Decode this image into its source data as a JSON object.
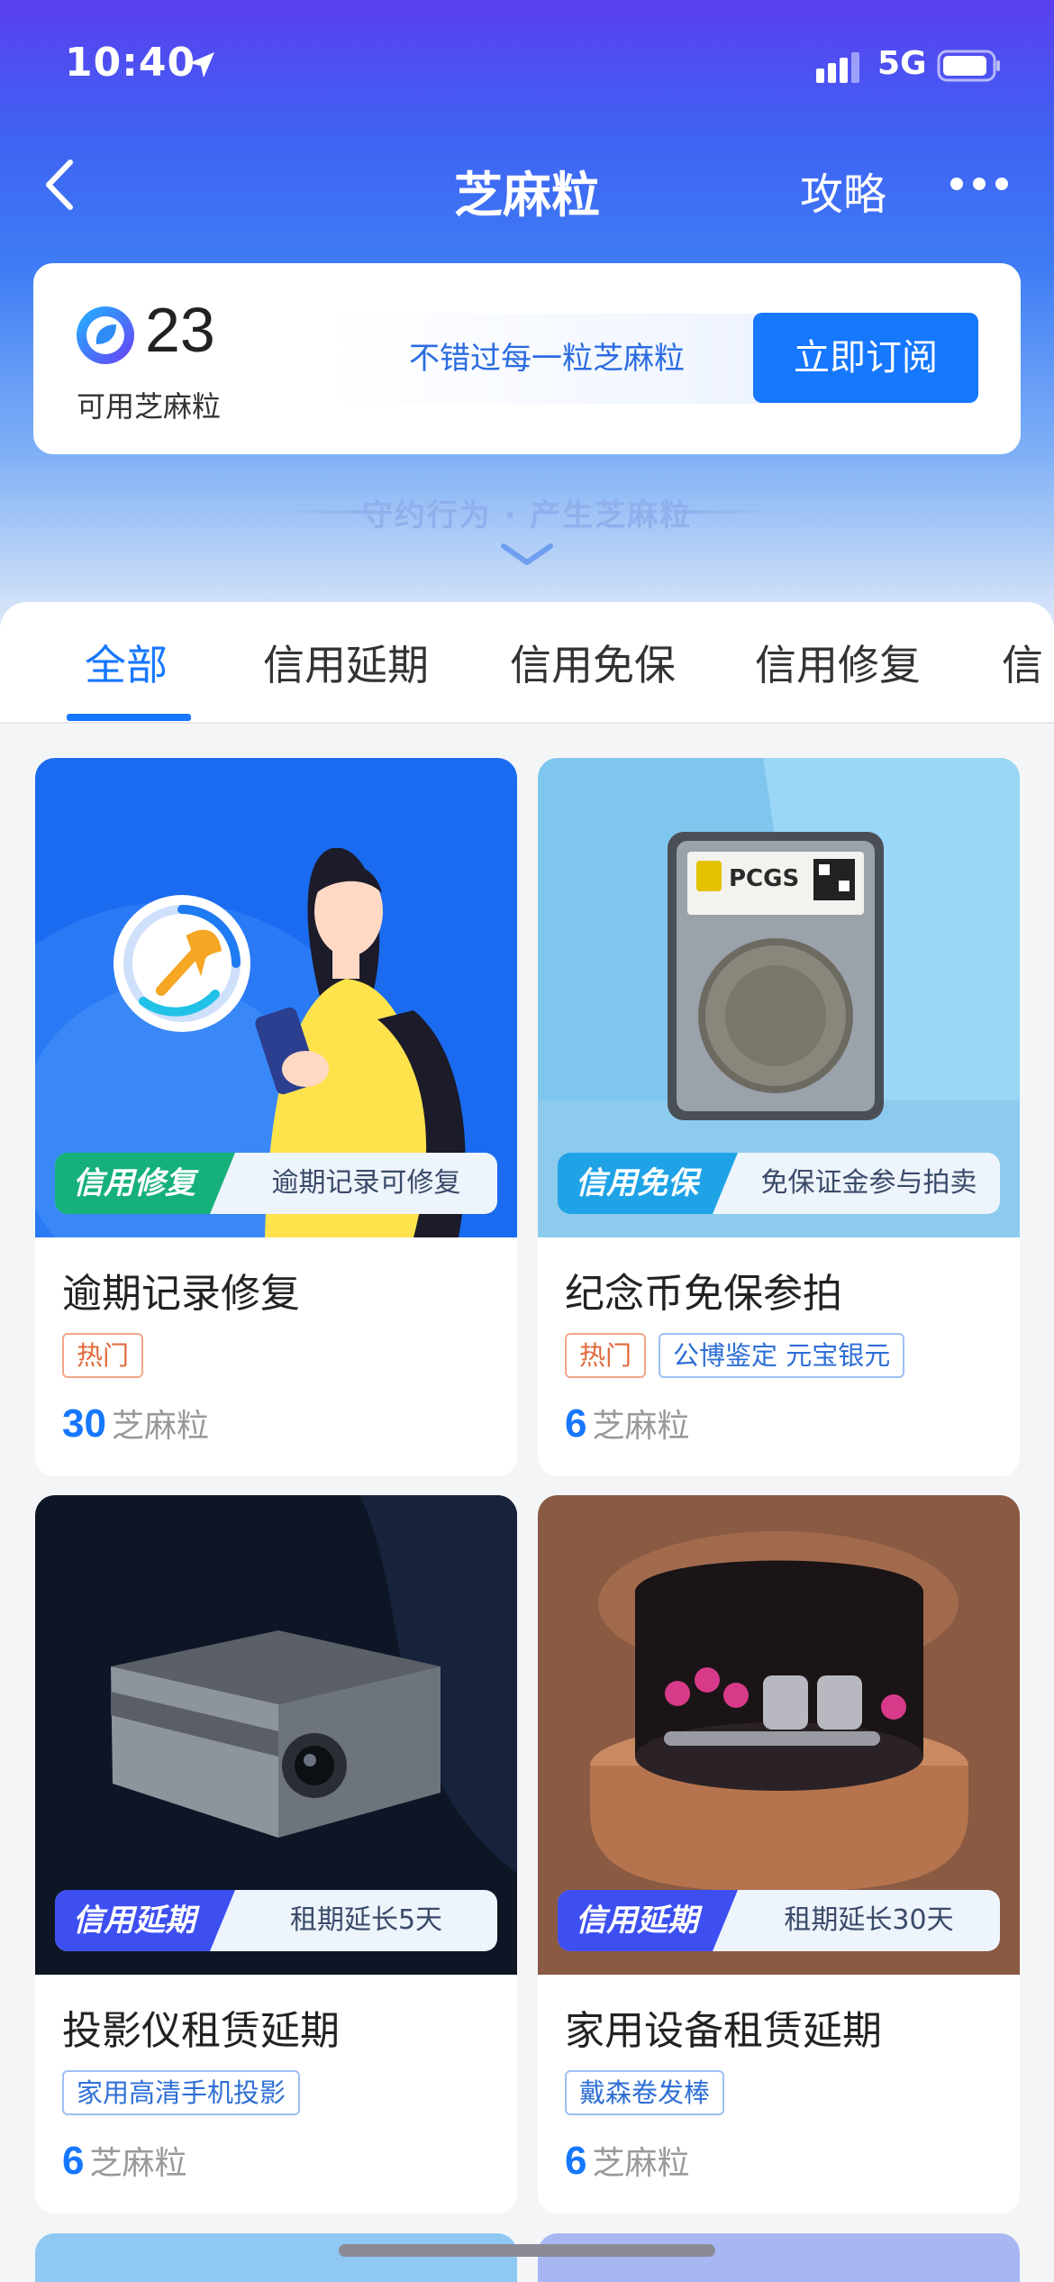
{
  "status_bar": {
    "time": "10:40",
    "network": "5G"
  },
  "nav": {
    "title": "芝麻粒",
    "guide": "攻略"
  },
  "sesame": {
    "count": "23",
    "label": "可用芝麻粒",
    "slogan": "不错过每一粒芝麻粒",
    "subscribe_label": "立即订阅"
  },
  "hero_tagline": "守约行为 · 产生芝麻粒",
  "tabs": [
    {
      "label": "全部",
      "active": true
    },
    {
      "label": "信用延期"
    },
    {
      "label": "信用免保"
    },
    {
      "label": "信用修复"
    },
    {
      "label": "信"
    }
  ],
  "cards": [
    {
      "badge_tag": "信用修复",
      "badge_text": "逾期记录可修复",
      "title": "逾期记录修复",
      "chips": [
        "热门"
      ],
      "points": "30",
      "unit": "芝麻粒"
    },
    {
      "badge_tag": "信用免保",
      "badge_text": "免保证金参与拍卖",
      "title": "纪念币免保参拍",
      "chips": [
        "热门",
        "公博鉴定 元宝银元"
      ],
      "points": "6",
      "unit": "芝麻粒"
    },
    {
      "badge_tag": "信用延期",
      "badge_text": "租期延长5天",
      "title": "投影仪租赁延期",
      "chips": [
        "家用高清手机投影"
      ],
      "points": "6",
      "unit": "芝麻粒"
    },
    {
      "badge_tag": "信用延期",
      "badge_text": "租期延长30天",
      "title": "家用设备租赁延期",
      "chips": [
        "戴森卷发棒"
      ],
      "points": "6",
      "unit": "芝麻粒"
    }
  ],
  "colors": {
    "accent": "#1677ff",
    "repair_tag": "#16b07a",
    "waiver_tag": "#1fa3e6",
    "extend_tag": "#3d4ff0"
  }
}
